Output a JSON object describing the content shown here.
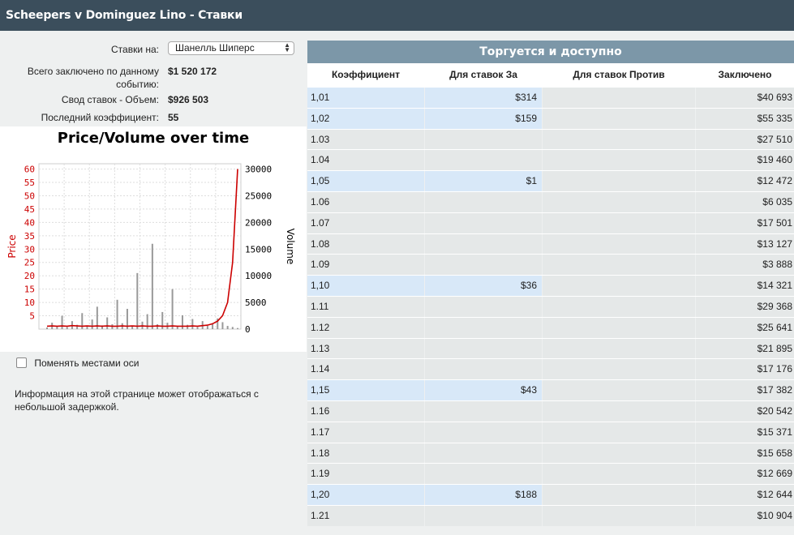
{
  "title": "Scheepers v Dominguez Lino - Ставки",
  "info": {
    "bets_on_label": "Ставки на:",
    "bets_on_value": "Шанелль Шиперс",
    "total_label_line1": "Всего заключено по данному",
    "total_label_line2": "событию:",
    "total_value": "$1 520 172",
    "summary_label": "Свод ставок - Объем:",
    "summary_value": "$926 503",
    "last_odds_label": "Последний коэффициент:",
    "last_odds_value": "55"
  },
  "chart": {
    "title": "Price/Volume over time",
    "price_axis_label": "Price",
    "volume_axis_label": "Volume",
    "price_ticks": [
      "5",
      "10",
      "15",
      "20",
      "25",
      "30",
      "35",
      "40",
      "45",
      "50",
      "55",
      "60"
    ],
    "volume_ticks": [
      "0",
      "5000",
      "10000",
      "15000",
      "20000",
      "25000",
      "30000"
    ],
    "price_color": "#cc0000",
    "volume_color": "#999999"
  },
  "chart_data": {
    "type": "line",
    "title": "Price/Volume over time",
    "xlabel": "",
    "ylabel": "Price",
    "y2label": "Volume",
    "ylim": [
      0,
      62
    ],
    "y2lim": [
      0,
      31000
    ],
    "series": [
      {
        "name": "Price",
        "axis": "left",
        "values": [
          1.1,
          1.2,
          1.1,
          1.2,
          1.1,
          1.3,
          1.2,
          1.1,
          1.2,
          1.1,
          1.2,
          1.1,
          1.2,
          1.1,
          1.1,
          1.2,
          1.1,
          1.2,
          1.1,
          1.2,
          1.1,
          1.1,
          1.2,
          1.1,
          1.1,
          1.2,
          1.1,
          1.1,
          1.1,
          1.2,
          1.1,
          1.3,
          1.5,
          2,
          3,
          5,
          10,
          25,
          60
        ]
      },
      {
        "name": "Volume",
        "axis": "right",
        "values": [
          300,
          1200,
          600,
          2500,
          400,
          1500,
          800,
          3000,
          500,
          1800,
          4200,
          700,
          2200,
          900,
          5500,
          1100,
          3800,
          600,
          10500,
          1400,
          2800,
          16000,
          900,
          3200,
          1200,
          7500,
          500,
          2600,
          800,
          1900,
          400,
          1500,
          600,
          1000,
          2000,
          1300,
          600,
          400,
          200
        ]
      }
    ]
  },
  "swap_axes_label": "Поменять местами оси",
  "note": "Информация на этой странице может отображаться с небольшой задержкой.",
  "table": {
    "header": "Торгуется и доступно",
    "columns": [
      "Коэффициент",
      "Для ставок За",
      "Для ставок Против",
      "Заключено"
    ],
    "rows": [
      {
        "odds": "1,01",
        "back": "$314",
        "lay": "",
        "volume": "$40 693",
        "hl": true
      },
      {
        "odds": "1,02",
        "back": "$159",
        "lay": "",
        "volume": "$55 335",
        "hl": true
      },
      {
        "odds": "1.03",
        "back": "",
        "lay": "",
        "volume": "$27 510",
        "hl": false
      },
      {
        "odds": "1.04",
        "back": "",
        "lay": "",
        "volume": "$19 460",
        "hl": false
      },
      {
        "odds": "1,05",
        "back": "$1",
        "lay": "",
        "volume": "$12 472",
        "hl": true
      },
      {
        "odds": "1.06",
        "back": "",
        "lay": "",
        "volume": "$6 035",
        "hl": false
      },
      {
        "odds": "1.07",
        "back": "",
        "lay": "",
        "volume": "$17 501",
        "hl": false
      },
      {
        "odds": "1.08",
        "back": "",
        "lay": "",
        "volume": "$13 127",
        "hl": false
      },
      {
        "odds": "1.09",
        "back": "",
        "lay": "",
        "volume": "$3 888",
        "hl": false
      },
      {
        "odds": "1,10",
        "back": "$36",
        "lay": "",
        "volume": "$14 321",
        "hl": true
      },
      {
        "odds": "1.11",
        "back": "",
        "lay": "",
        "volume": "$29 368",
        "hl": false
      },
      {
        "odds": "1.12",
        "back": "",
        "lay": "",
        "volume": "$25 641",
        "hl": false
      },
      {
        "odds": "1.13",
        "back": "",
        "lay": "",
        "volume": "$21 895",
        "hl": false
      },
      {
        "odds": "1.14",
        "back": "",
        "lay": "",
        "volume": "$17 176",
        "hl": false
      },
      {
        "odds": "1,15",
        "back": "$43",
        "lay": "",
        "volume": "$17 382",
        "hl": true
      },
      {
        "odds": "1.16",
        "back": "",
        "lay": "",
        "volume": "$20 542",
        "hl": false
      },
      {
        "odds": "1.17",
        "back": "",
        "lay": "",
        "volume": "$15 371",
        "hl": false
      },
      {
        "odds": "1.18",
        "back": "",
        "lay": "",
        "volume": "$15 658",
        "hl": false
      },
      {
        "odds": "1.19",
        "back": "",
        "lay": "",
        "volume": "$12 669",
        "hl": false
      },
      {
        "odds": "1,20",
        "back": "$188",
        "lay": "",
        "volume": "$12 644",
        "hl": true
      },
      {
        "odds": "1.21",
        "back": "",
        "lay": "",
        "volume": "$10 904",
        "hl": false
      }
    ]
  }
}
